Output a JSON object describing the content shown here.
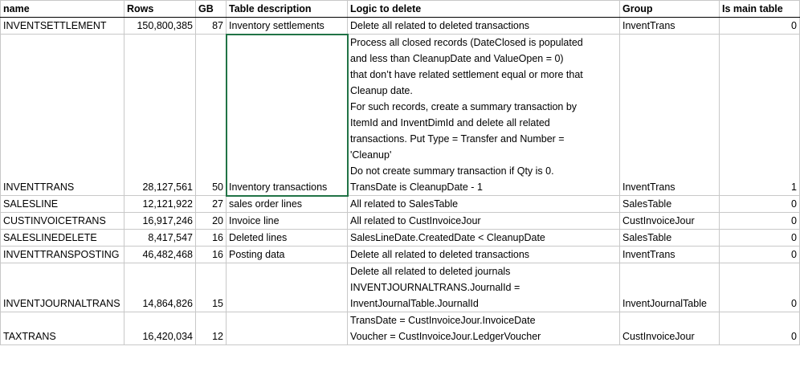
{
  "headers": {
    "name": "name",
    "rows": "Rows",
    "gb": "GB",
    "desc": "Table description",
    "logic": "Logic to delete",
    "group": "Group",
    "main": "Is main table"
  },
  "rows": [
    {
      "name": "INVENTSETTLEMENT",
      "rows": "150,800,385",
      "gb": "87",
      "desc": "Inventory settlements",
      "logic": [
        "Delete all related to deleted transactions"
      ],
      "group": "InventTrans",
      "main": "0"
    },
    {
      "name": "INVENTTRANS",
      "rows": "28,127,561",
      "gb": "50",
      "desc": "Inventory transactions",
      "logic": [
        "Process all closed records (DateClosed is populated",
        "and less than CleanupDate and ValueOpen = 0)",
        "that don’t have related settlement equal or more that",
        "Cleanup date.",
        "For such records, create a summary transaction by",
        "ItemId and InventDimId and delete all related",
        "transactions. Put Type = Transfer and Number =",
        "'Cleanup'",
        "Do not create summary transaction if Qty is 0.",
        "TransDate is CleanupDate - 1"
      ],
      "group": "InventTrans",
      "main": "1"
    },
    {
      "name": "SALESLINE",
      "rows": "12,121,922",
      "gb": "27",
      "desc": "sales order lines",
      "logic": [
        "All related to SalesTable"
      ],
      "group": "SalesTable",
      "main": "0"
    },
    {
      "name": "CUSTINVOICETRANS",
      "rows": "16,917,246",
      "gb": "20",
      "desc": "Invoice line",
      "logic": [
        "All related to CustInvoiceJour"
      ],
      "group": "CustInvoiceJour",
      "main": "0"
    },
    {
      "name": "SALESLINEDELETE",
      "rows": "8,417,547",
      "gb": "16",
      "desc": "Deleted lines",
      "logic": [
        "SalesLineDate.CreatedDate < CleanupDate"
      ],
      "group": "SalesTable",
      "main": "0"
    },
    {
      "name": "INVENTTRANSPOSTING",
      "rows": "46,482,468",
      "gb": "16",
      "desc": "Posting data",
      "logic": [
        "Delete all related to deleted transactions"
      ],
      "group": "InventTrans",
      "main": "0"
    },
    {
      "name": "INVENTJOURNALTRANS",
      "rows": "14,864,826",
      "gb": "15",
      "desc": "",
      "logic": [
        "Delete all related to deleted journals",
        "INVENTJOURNALTRANS.JournalId =",
        "InventJournalTable.JournalId"
      ],
      "group": "InventJournalTable",
      "main": "0"
    },
    {
      "name": "TAXTRANS",
      "rows": "16,420,034",
      "gb": "12",
      "desc": "",
      "logic": [
        "TransDate = CustInvoiceJour.InvoiceDate",
        "Voucher = CustInvoiceJour.LedgerVoucher"
      ],
      "group": "CustInvoiceJour",
      "main": "0"
    }
  ]
}
